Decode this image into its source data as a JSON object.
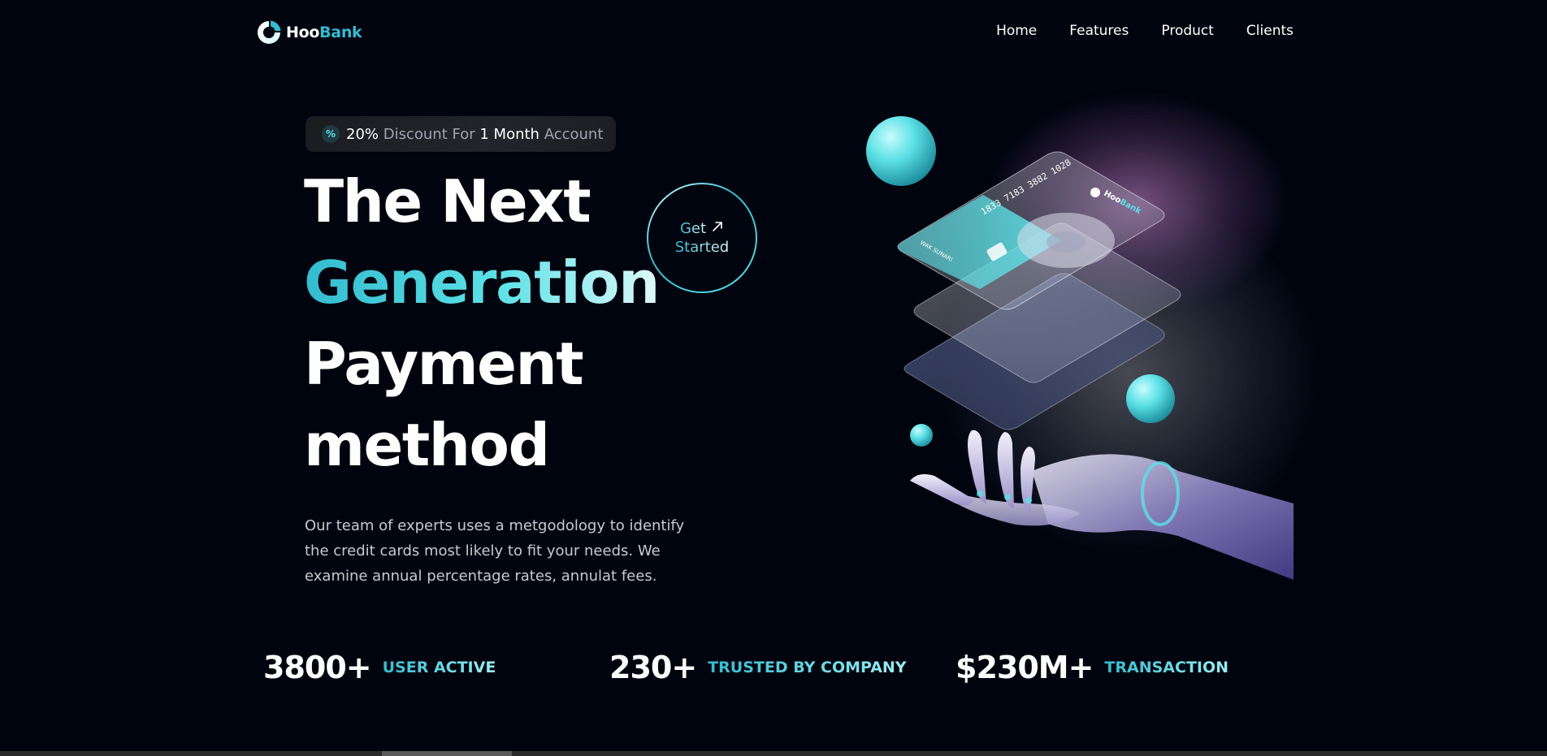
{
  "nav": {
    "logo": {
      "hoo": "Hoo",
      "bank": "Bank"
    },
    "links": [
      "Home",
      "Features",
      "Product",
      "Clients"
    ]
  },
  "hero": {
    "badge": {
      "icon": "percent-icon",
      "percent": "20%",
      "discount": "Discount",
      "for": "For",
      "month": "1 Month",
      "account": "Account"
    },
    "title": {
      "line1": "The Next",
      "line2": "Generation",
      "line3": "Payment",
      "line4": "method"
    },
    "cta": {
      "line1": "Get",
      "line2": "Started",
      "icon": "arrow-up-right-icon"
    },
    "description": "Our team of experts uses a metgodology to identify the credit cards most likely to fit your needs. We examine annual percentage rates, annulat fees."
  },
  "illustration": {
    "card_brand": {
      "hoo": "Hoo",
      "bank": "Bank"
    },
    "card_number": "1833 7183 3882 1028",
    "card_holder": "WAK SUNARI"
  },
  "stats": [
    {
      "value": "3800+",
      "label": "USER ACTIVE"
    },
    {
      "value": "230+",
      "label": "TRUSTED BY COMPANY"
    },
    {
      "value": "$230M+",
      "label": "TRANSACTION"
    }
  ],
  "colors": {
    "background": "#00040f",
    "accent": "#33bbcf",
    "accent_light": "#5ce1e6"
  }
}
